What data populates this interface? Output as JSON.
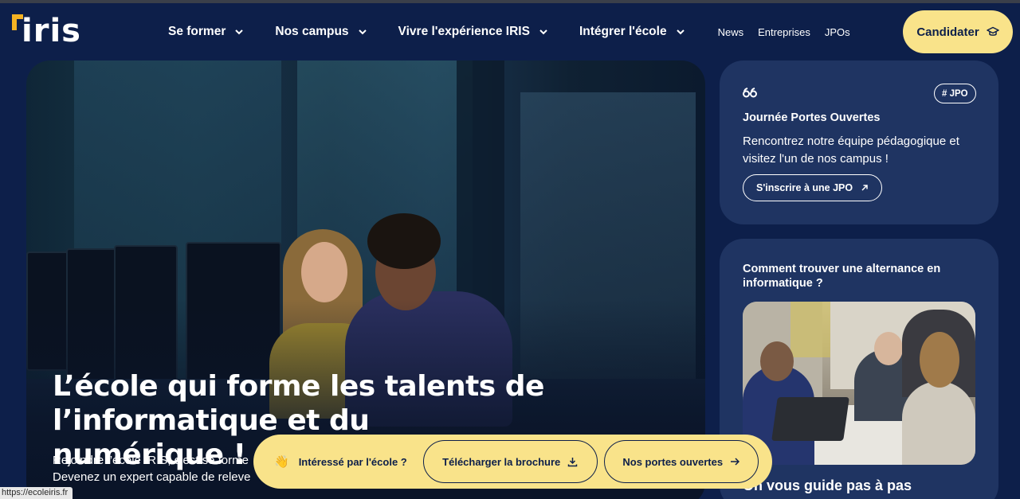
{
  "header": {
    "logo_text": "iris",
    "nav": [
      {
        "label": "Se former"
      },
      {
        "label": "Nos campus"
      },
      {
        "label": "Vivre l'expérience IRIS"
      },
      {
        "label": "Intégrer l'école"
      }
    ],
    "links": [
      "News",
      "Entreprises",
      "JPOs"
    ],
    "cta_label": "Candidater"
  },
  "hero": {
    "title": "L’école qui forme les talents de l’informatique et du numérique !",
    "text_line1": "Rejoindre l’école IRIS, c’est se forme",
    "text_line2": "Devenez un expert capable de releve"
  },
  "jpo_card": {
    "tag": "# JPO",
    "title": "Journée Portes Ouvertes",
    "text": "Rencontrez notre équipe pédagogique et visitez l'un de nos campus !",
    "button": "S'inscrire à une JPO"
  },
  "article_card": {
    "title": "Comment trouver une alternance en informatique ?",
    "footer": "On vous guide pas à pas"
  },
  "sticky_bar": {
    "hand": "👋",
    "label": "Intéressé par l'école ?",
    "brochure": "Télécharger la brochure",
    "open_days": "Nos portes ouvertes"
  },
  "status_bar": {
    "url": "https://ecoleiris.fr"
  },
  "colors": {
    "background": "#0d1f4a",
    "card": "#1f3462",
    "accent_yellow": "#f9e38a",
    "logo_orange": "#f5b323"
  }
}
